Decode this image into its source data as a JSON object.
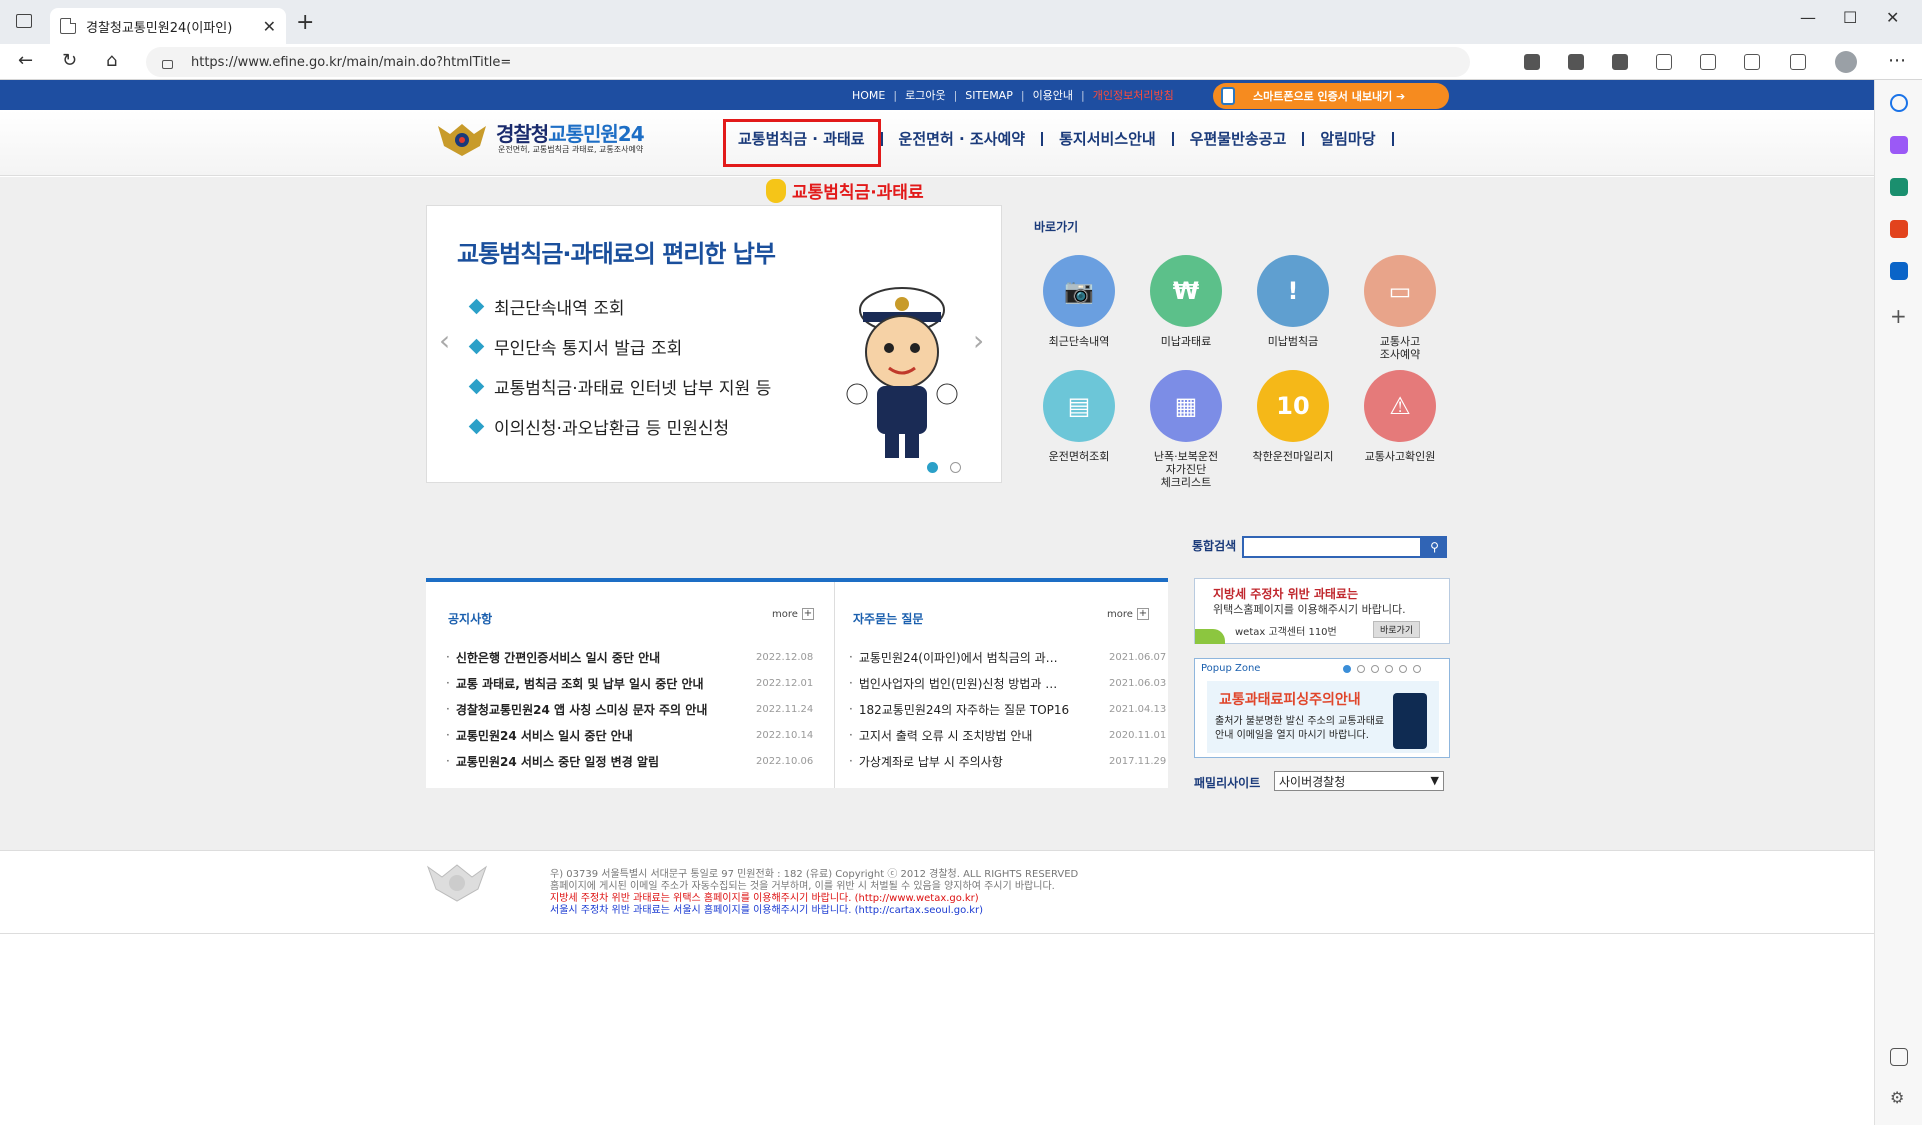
{
  "browser": {
    "tab_title": "경찰청교통민원24(이파인)",
    "url": "https://www.efine.go.kr/main/main.do?htmlTitle="
  },
  "top_links": [
    "HOME",
    "로그아웃",
    "SITEMAP",
    "이용안내",
    "개인정보처리방침"
  ],
  "smart_button": "스마트폰으로 인증서 내보내기",
  "logo": {
    "title_a": "경찰청",
    "title_b": "교통민원24",
    "subtitle": "운전면허, 교통범칙금 과태료, 교통조사예약"
  },
  "gnb": [
    "교통범칙금 · 과태료",
    "운전면허 · 조사예약",
    "통지서비스안내",
    "우편물반송공고",
    "알림마당"
  ],
  "hint_text": "교통범칙금·과태료",
  "banner": {
    "title": "교통범칙금·과태료의 편리한 납부",
    "items": [
      "최근단속내역 조회",
      "무인단속 통지서 발급 조회",
      "교통범칙금·과태료 인터넷 납부 지원 등",
      "이의신청·과오납환급 등 민원신청"
    ]
  },
  "quick": {
    "title": "바로가기",
    "items": [
      {
        "label": "최근단속내역",
        "color": "#6a9fe0"
      },
      {
        "label": "미납과태료",
        "color": "#5cc08a"
      },
      {
        "label": "미납범칙금",
        "color": "#5f9fd0"
      },
      {
        "label": "교통사고\n조사예약",
        "color": "#e8a48a"
      },
      {
        "label": "운전면허조회",
        "color": "#6cc6d8"
      },
      {
        "label": "난폭·보복운전\n자가진단\n체크리스트",
        "color": "#7c8de6"
      },
      {
        "label": "착한운전마일리지",
        "color": "#f5b818"
      },
      {
        "label": "교통사고확인원",
        "color": "#e57a7a"
      }
    ]
  },
  "search": {
    "label": "통합검색",
    "placeholder": ""
  },
  "notice": {
    "title": "공지사항",
    "more": "more",
    "rows": [
      {
        "text": "신한은행 간편인증서비스 일시 중단 안내",
        "date": "2022.12.08"
      },
      {
        "text": "교통 과태료, 범칙금 조회 및 납부 일시 중단 안내",
        "date": "2022.12.01"
      },
      {
        "text": "경찰청교통민원24 앱 사칭 스미싱 문자 주의 안내",
        "date": "2022.11.24"
      },
      {
        "text": "교통민원24 서비스 일시 중단 안내",
        "date": "2022.10.14"
      },
      {
        "text": "교통민원24 서비스 중단 일정 변경 알림",
        "date": "2022.10.06"
      }
    ]
  },
  "faq": {
    "title": "자주묻는 질문",
    "more": "more",
    "rows": [
      {
        "text": "교통민원24(이파인)에서 범칙금의 과…",
        "date": "2021.06.07"
      },
      {
        "text": "법인사업자의 법인(민원)신청 방법과 …",
        "date": "2021.06.03"
      },
      {
        "text": "182교통민원24의 자주하는 질문 TOP16",
        "date": "2021.04.13"
      },
      {
        "text": "고지서 출력 오류 시 조치방법 안내",
        "date": "2020.11.01"
      },
      {
        "text": "가상계좌로 납부 시 주의사항",
        "date": "2017.11.29"
      }
    ]
  },
  "wetax": {
    "line1": "지방세 주정차 위반 과태료는",
    "line2": "위택스홈페이지를 이용해주시기 바랍니다.",
    "line3": "wetax 고객센터 110번",
    "go": "바로가기"
  },
  "popup": {
    "zone": "Popup Zone",
    "title": "교통과태료피싱주의안내",
    "body1": "출처가 불분명한 발신 주소의 교통과태료",
    "body2": "안내 이메일을 열지 마시기 바랍니다."
  },
  "family": {
    "label": "패밀리사이트",
    "selected": "사이버경찰청"
  },
  "footer": {
    "line1": "우) 03739 서울특별시 서대문구 통일로 97  민원전화 : 182 (유료)        Copyright ⓒ 2012 경찰청. ALL RIGHTS RESERVED",
    "line2": "홈페이지에 게시된 이메일 주소가 자동수집되는 것을 거부하며, 이를 위반 시 처벌될 수 있음을 양지하여 주시기 바랍니다.",
    "line3": "지방세 주정차 위반 과태료는 위택스 홈페이지를 이용해주시기 바랍니다. (http://www.wetax.go.kr)",
    "line4": "서울시 주정차 위반 과태료는 서울시 홈페이지를 이용해주시기 바랍니다. (http://cartax.seoul.go.kr)"
  }
}
